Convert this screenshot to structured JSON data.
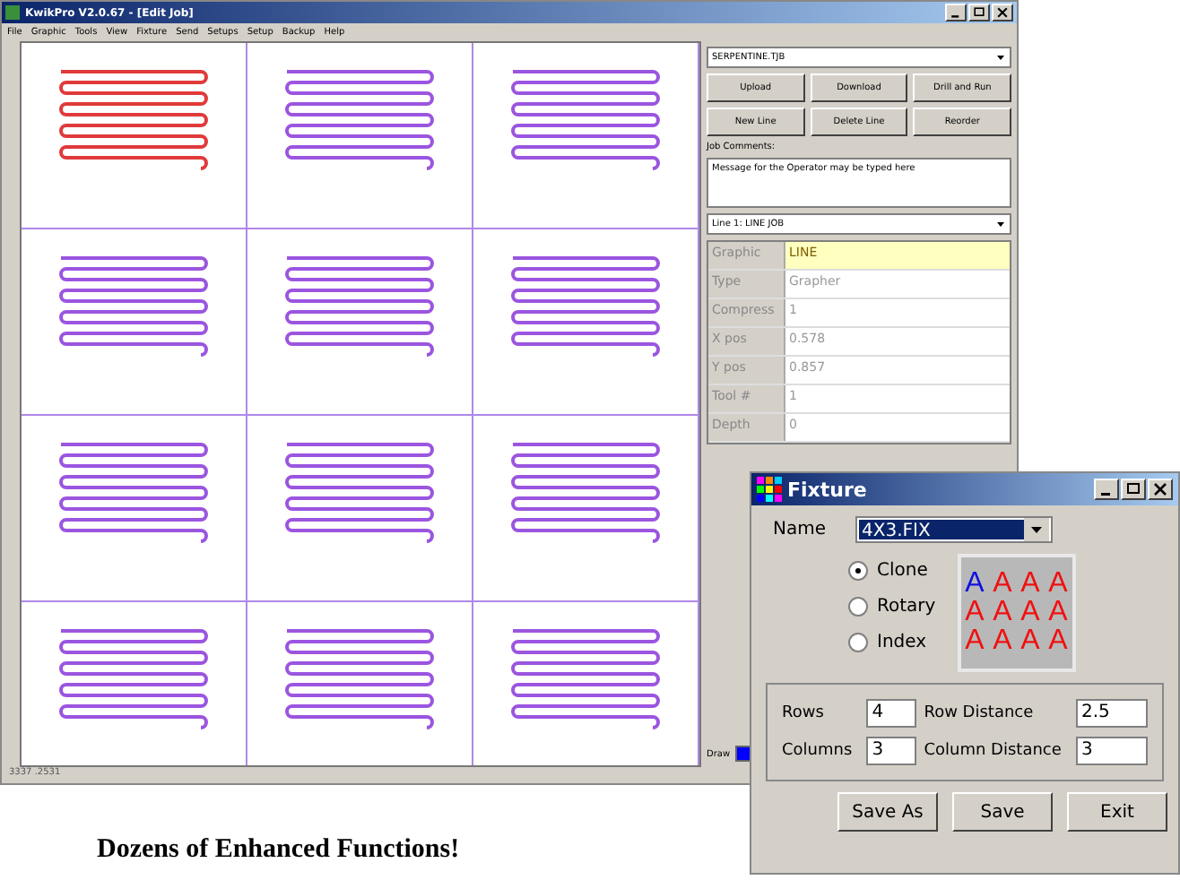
{
  "main_window": {
    "title": "KwikPro V2.0.67 - [Edit Job]",
    "menu": [
      "File",
      "Graphic",
      "Tools",
      "View",
      "Fixture",
      "Send",
      "Setups",
      "Setup",
      "Backup",
      "Help"
    ],
    "canvas_cells": [
      {
        "color": "#e03a3a"
      },
      {
        "color": "#9b55e0"
      },
      {
        "color": "#9b55e0"
      },
      {
        "color": "#9b55e0"
      },
      {
        "color": "#9b55e0"
      },
      {
        "color": "#9b55e0"
      },
      {
        "color": "#9b55e0"
      },
      {
        "color": "#9b55e0"
      },
      {
        "color": "#9b55e0"
      },
      {
        "color": "#9b55e0"
      },
      {
        "color": "#9b55e0"
      },
      {
        "color": "#9b55e0"
      }
    ],
    "job_file": "SERPENTINE.TJB",
    "buttons": [
      "Upload",
      "Download",
      "Drill and Run",
      "New Line",
      "Delete Line",
      "Reorder"
    ],
    "comments_label": "Job Comments:",
    "comments": "Message for the Operator may be typed here",
    "line_select": "Line 1: LINE JOB",
    "properties": [
      {
        "label": "Graphic",
        "value": "LINE",
        "selected": true
      },
      {
        "label": "Type",
        "value": "Grapher",
        "selected": false
      },
      {
        "label": "Compress",
        "value": "1",
        "selected": false
      },
      {
        "label": "X pos",
        "value": "0.578",
        "selected": false
      },
      {
        "label": "Y pos",
        "value": "0.857",
        "selected": false
      },
      {
        "label": "Tool #",
        "value": "1",
        "selected": false
      },
      {
        "label": "Depth",
        "value": "0",
        "selected": false
      }
    ],
    "draw": {
      "label": "Draw",
      "checked": true
    },
    "status": "3337 .2531"
  },
  "caption": "Dozens of Enhanced Functions!",
  "fixture_dialog": {
    "title": "Fixture",
    "name_label": "Name",
    "name_value": "4X3.FIX",
    "modes": [
      {
        "label": "Clone",
        "selected": true
      },
      {
        "label": "Rotary",
        "selected": false
      },
      {
        "label": "Index",
        "selected": false
      }
    ],
    "preview": [
      {
        "letter": "A",
        "color": "#1010e0"
      },
      {
        "letter": "A",
        "color": "#f01010"
      },
      {
        "letter": "A",
        "color": "#f01010"
      },
      {
        "letter": "A",
        "color": "#f01010"
      },
      {
        "letter": "A",
        "color": "#f01010"
      },
      {
        "letter": "A",
        "color": "#f01010"
      },
      {
        "letter": "A",
        "color": "#f01010"
      },
      {
        "letter": "A",
        "color": "#f01010"
      },
      {
        "letter": "A",
        "color": "#f01010"
      },
      {
        "letter": "A",
        "color": "#f01010"
      },
      {
        "letter": "A",
        "color": "#f01010"
      },
      {
        "letter": "A",
        "color": "#f01010"
      }
    ],
    "fields": [
      {
        "label": "Rows",
        "value": "4"
      },
      {
        "label": "Row Distance",
        "value": "2.5"
      },
      {
        "label": "Columns",
        "value": "3"
      },
      {
        "label": "Column Distance",
        "value": "3"
      }
    ],
    "buttons": [
      "Save As",
      "Save",
      "Exit"
    ]
  }
}
